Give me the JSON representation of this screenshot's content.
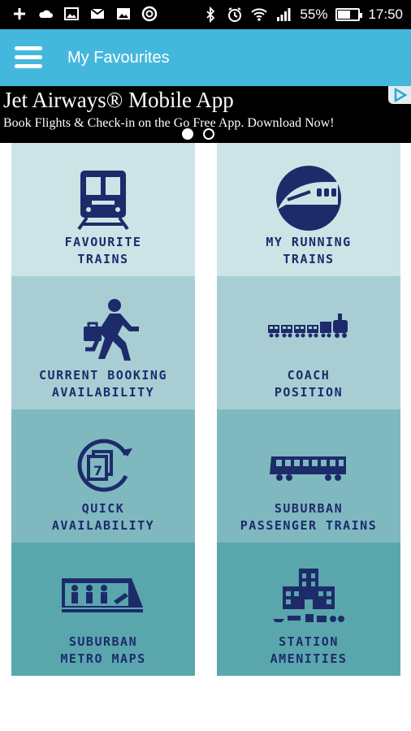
{
  "status_bar": {
    "battery_percent": "55%",
    "time": "17:50",
    "battery_level": 0.55,
    "left_icons": [
      "plus-icon",
      "cloud-icon",
      "image-icon",
      "mail-icon",
      "photo-mail-icon",
      "app-circle-icon"
    ],
    "right_icons": [
      "bluetooth-icon",
      "alarm-icon",
      "wifi-icon",
      "signal-icon"
    ]
  },
  "app_bar": {
    "title": "My Favourites",
    "menu_icon": "hamburger-menu-icon",
    "background": "#44b8dc"
  },
  "ad": {
    "title": "Jet Airways® Mobile App",
    "subtitle": "Book Flights & Check-in on the Go Free App. Download Now!",
    "active_dot": 0,
    "dot_count": 2
  },
  "tiles": [
    {
      "line1": "FAVOURITE",
      "line2": "TRAINS",
      "icon": "train-front-icon",
      "bg": "#cde3e6"
    },
    {
      "line1": "MY RUNNING",
      "line2": "TRAINS",
      "icon": "bullet-train-icon",
      "bg": "#cde3e6"
    },
    {
      "line1": "CURRENT BOOKING",
      "line2": "AVAILABILITY",
      "icon": "running-man-icon",
      "bg": "#a8ced4"
    },
    {
      "line1": "COACH",
      "line2": "POSITION",
      "icon": "train-coaches-icon",
      "bg": "#a8ced4"
    },
    {
      "line1": "QUICK",
      "line2": "AVAILABILITY",
      "icon": "calendar-refresh-icon",
      "bg": "#80b8c0"
    },
    {
      "line1": "SUBURBAN",
      "line2": "PASSENGER TRAINS",
      "icon": "suburban-train-icon",
      "bg": "#80b8c0"
    },
    {
      "line1": "SUBURBAN",
      "line2": "METRO MAPS",
      "icon": "metro-passengers-icon",
      "bg": "#5aa6ad"
    },
    {
      "line1": "STATION",
      "line2": "AMENITIES",
      "icon": "station-building-icon",
      "bg": "#5aa6ad"
    }
  ],
  "colors": {
    "icon_navy": "#1d2b6b",
    "label_navy": "#1d2b6b"
  }
}
